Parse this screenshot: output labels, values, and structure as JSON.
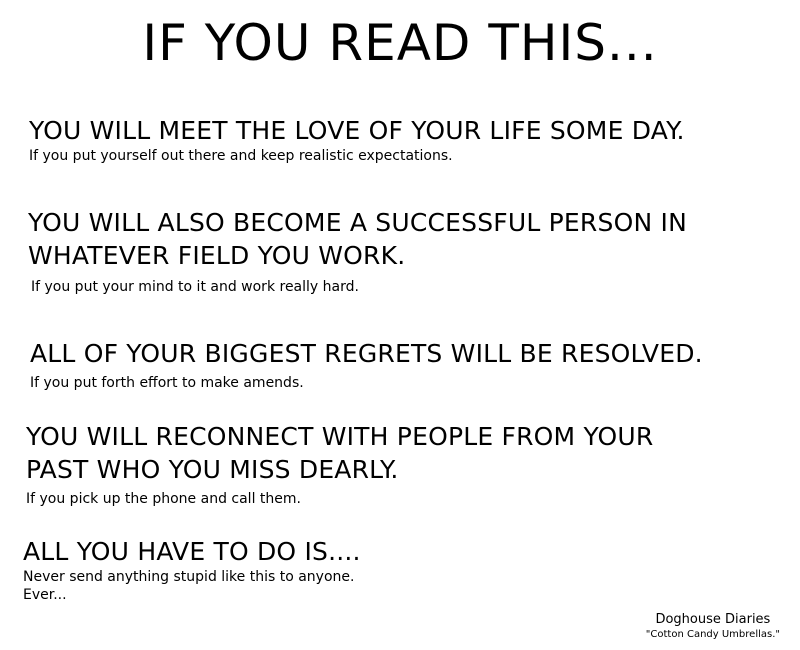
{
  "title": "IF YOU READ THIS...",
  "statements": [
    {
      "lines": [
        "YOU WILL MEET THE LOVE OF YOUR LIFE SOME DAY."
      ],
      "condition": "If you put yourself out there and keep realistic expectations."
    },
    {
      "lines": [
        "YOU WILL ALSO BECOME A SUCCESSFUL PERSON IN",
        "WHATEVER FIELD YOU WORK."
      ],
      "condition": "If you put your mind to it and work really hard."
    },
    {
      "lines": [
        "ALL OF YOUR BIGGEST REGRETS WILL BE RESOLVED."
      ],
      "condition": "If you put forth effort to make amends."
    },
    {
      "lines": [
        "YOU WILL RECONNECT WITH PEOPLE FROM YOUR",
        "PAST WHO YOU MISS DEARLY."
      ],
      "condition": "If you pick up the phone and call them."
    }
  ],
  "ending": {
    "headline": "ALL YOU HAVE TO DO IS....",
    "lines": [
      "Never send anything stupid like this to anyone.",
      "Ever..."
    ]
  },
  "credit": {
    "name": "Doghouse Diaries",
    "title": "\"Cotton Candy Umbrellas.\""
  }
}
